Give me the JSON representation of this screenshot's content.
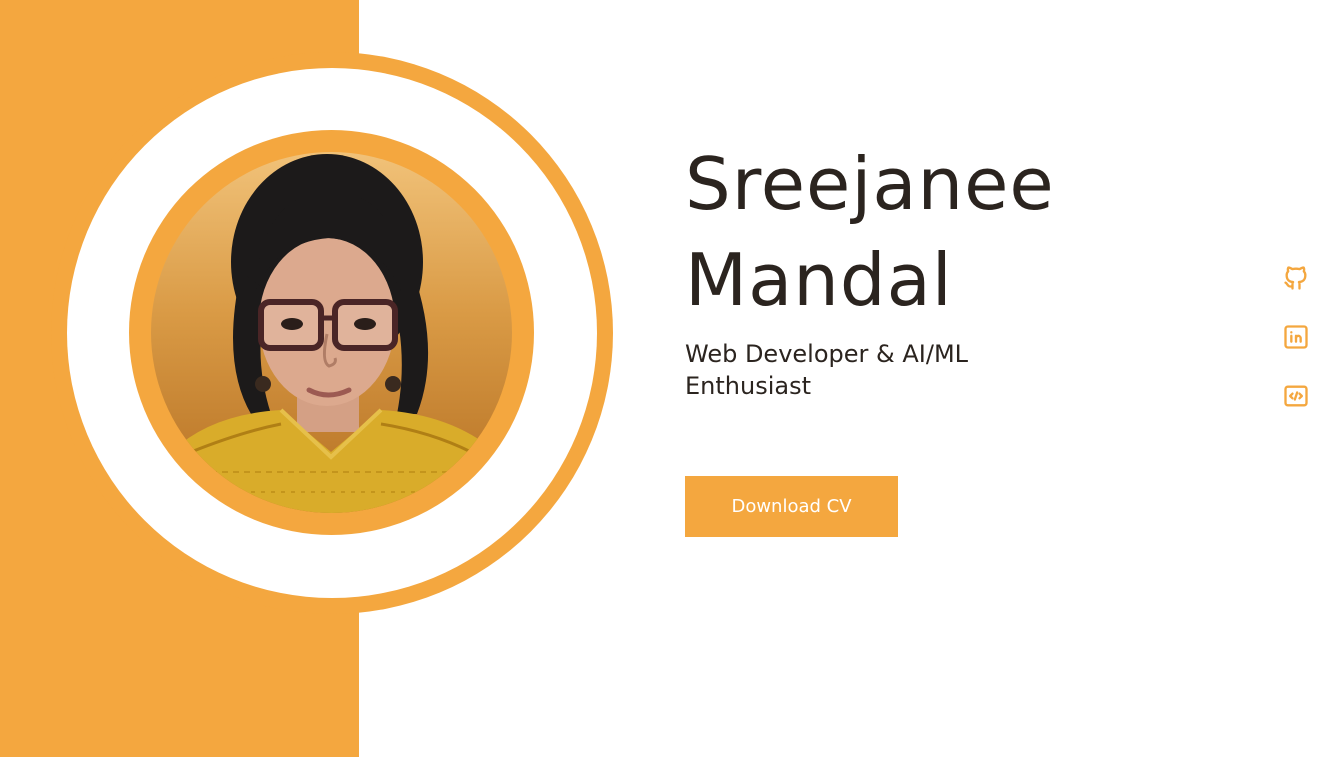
{
  "profile": {
    "name_line1": "Sreejanee",
    "name_line2": "Mandal",
    "role": "Web Developer & AI/ML Enthusiast",
    "cv_button_label": "Download CV"
  },
  "social": {
    "items": [
      {
        "name": "github-icon"
      },
      {
        "name": "linkedin-icon"
      },
      {
        "name": "code-icon"
      }
    ]
  },
  "colors": {
    "accent": "#f4a73f",
    "text": "#2b241f",
    "background": "#ffffff"
  }
}
